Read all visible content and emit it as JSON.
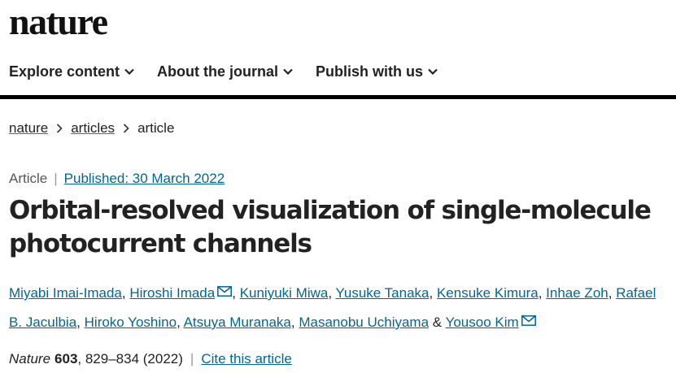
{
  "header": {
    "logo": "nature"
  },
  "nav": {
    "items": [
      {
        "label": "Explore content"
      },
      {
        "label": "About the journal"
      },
      {
        "label": "Publish with us"
      }
    ]
  },
  "breadcrumb": {
    "items": [
      "nature",
      "articles",
      "article"
    ]
  },
  "article": {
    "type": "Article",
    "published": "Published: 30 March 2022",
    "title_line1": "Orbital-resolved visualization of single-molecule",
    "title_line2": "photocurrent channels",
    "authors": [
      "Miyabi Imai-Imada",
      "Hiroshi Imada",
      "Kuniyuki Miwa",
      "Yusuke Tanaka",
      "Kensuke Kimura",
      "Inhae Zoh",
      "Rafael",
      "B. Jaculbia",
      "Hiroko Yoshino",
      "Atsuya Muranaka",
      "Masanobu Uchiyama",
      "Yousoo Kim"
    ],
    "separator": ",",
    "last_separator": "&",
    "journal": "Nature",
    "volume": "603",
    "pages_year": ", 829–834 (2022)",
    "cite_label": "Cite this article"
  },
  "colors": {
    "link": "#006699",
    "text": "#222222",
    "rule": "#000000"
  }
}
